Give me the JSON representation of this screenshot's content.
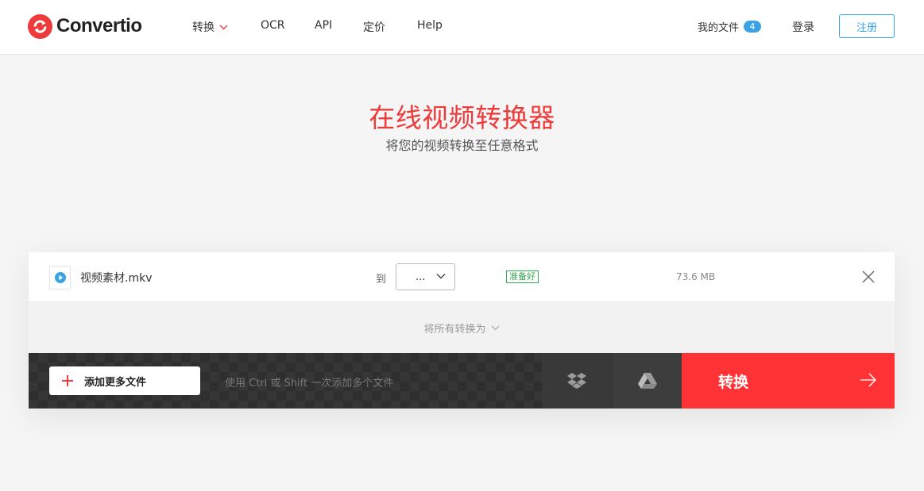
{
  "header": {
    "logo_text": "Convertio",
    "nav": [
      {
        "label": "转换",
        "has_dropdown": true
      },
      {
        "label": "OCR"
      },
      {
        "label": "API"
      },
      {
        "label": "定价"
      },
      {
        "label": "Help"
      }
    ],
    "my_files_label": "我的文件",
    "my_files_count": "4",
    "login_label": "登录",
    "signup_label": "注册"
  },
  "hero": {
    "title": "在线视频转换器",
    "subtitle": "将您的视频转换至任意格式"
  },
  "file": {
    "name": "视频素材.mkv",
    "to_label": "到",
    "format_value": "...",
    "status": "准备好",
    "size": "73.6 MB"
  },
  "convert_all_label": "将所有转换为",
  "action_bar": {
    "add_label": "添加更多文件",
    "hint": "使用 Ctrl 或 Shift 一次添加多个文件",
    "convert_label": "转换"
  },
  "colors": {
    "brand_red": "#ed3b3b",
    "convert_red": "#ff3335",
    "accent_blue": "#3aa3e3",
    "ready_green": "#34a853"
  }
}
